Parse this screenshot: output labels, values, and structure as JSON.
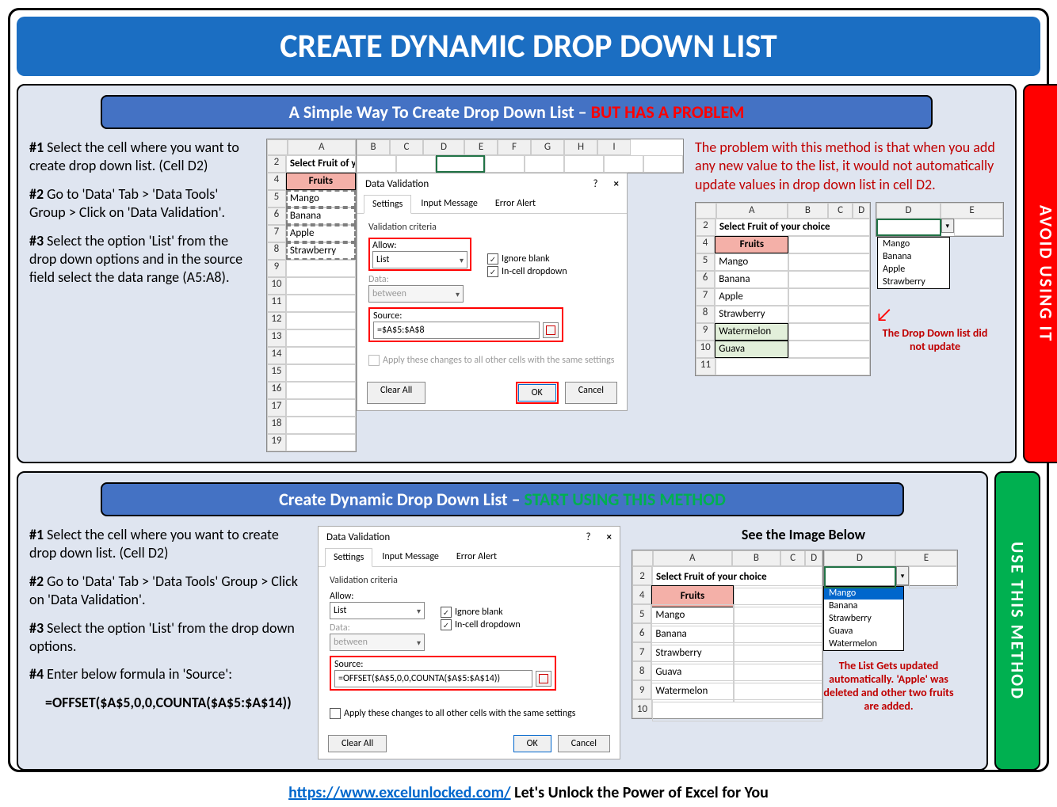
{
  "title": "CREATE DYNAMIC DROP DOWN LIST",
  "section1": {
    "header_a": "A Simple Way To Create Drop Down List – ",
    "header_b": "BUT HAS A PROBLEM",
    "side_label": "AVOID USING IT",
    "step1": " Select the cell where you want to create drop down list. (Cell D2)",
    "step2": " Go to 'Data' Tab > 'Data Tools' Group > Click on 'Data Validation'.",
    "step3": " Select the option 'List' from the drop down options and in the source field select the data range (A5:A8).",
    "problem": "The problem with this method is that when you add any new value to the list, it would not automatically update values in drop down list in cell D2.",
    "annot": "The Drop Down list did not update",
    "left_excel": {
      "prompt": "Select Fruit of your choice",
      "header": "Fruits",
      "items": [
        "Mango",
        "Banana",
        "Apple",
        "Strawberry"
      ]
    },
    "dialog": {
      "title": "Data Validation",
      "tabs": [
        "Settings",
        "Input Message",
        "Error Alert"
      ],
      "criteria": "Validation criteria",
      "allow_label": "Allow:",
      "allow_value": "List",
      "data_label": "Data:",
      "data_value": "between",
      "ignore": "Ignore blank",
      "incell": "In-cell dropdown",
      "source_label": "Source:",
      "source_value": "=$A$5:$A$8",
      "apply": "Apply these changes to all other cells with the same settings",
      "clear": "Clear All",
      "ok": "OK",
      "cancel": "Cancel"
    },
    "right_excel": {
      "prompt": "Select Fruit of your choice",
      "header": "Fruits",
      "items": [
        "Mango",
        "Banana",
        "Apple",
        "Strawberry",
        "Watermelon",
        "Guava"
      ],
      "dropdown": [
        "Mango",
        "Banana",
        "Apple",
        "Strawberry"
      ]
    }
  },
  "section2": {
    "header_a": "Create Dynamic Drop Down List – ",
    "header_b": "START USING THIS METHOD",
    "side_label": "USE THIS METHOD",
    "step1": " Select the cell where you want to create drop down list. (Cell D2)",
    "step2": " Go to 'Data' Tab > 'Data Tools' Group > Click on 'Data Validation'.",
    "step3": " Select the option 'List' from the drop down options.",
    "step4": " Enter below formula in 'Source':",
    "formula": "=OFFSET($A$5,0,0,COUNTA($A$5:$A$14))",
    "dialog": {
      "title": "Data Validation",
      "tabs": [
        "Settings",
        "Input Message",
        "Error Alert"
      ],
      "criteria": "Validation criteria",
      "allow_label": "Allow:",
      "allow_value": "List",
      "data_label": "Data:",
      "data_value": "between",
      "ignore": "Ignore blank",
      "incell": "In-cell dropdown",
      "source_label": "Source:",
      "source_value": "=OFFSET($A$5,0,0,COUNTA($A$5:$A$14))",
      "apply": "Apply these changes to all other cells with the same settings",
      "clear": "Clear All",
      "ok": "OK",
      "cancel": "Cancel"
    },
    "see_below": "See the Image Below",
    "right_excel": {
      "prompt": "Select Fruit of your choice",
      "header": "Fruits",
      "items": [
        "Mango",
        "Banana",
        "Strawberry",
        "Guava",
        "Watermelon"
      ],
      "dropdown": [
        "Mango",
        "Banana",
        "Strawberry",
        "Guava",
        "Watermelon"
      ]
    },
    "annot": "The List Gets updated automatically. 'Apple' was deleted and other two fruits are added."
  },
  "footer": {
    "url": "https://www.excelunlocked.com/",
    "tagline": " Let's Unlock the Power of Excel for You"
  }
}
